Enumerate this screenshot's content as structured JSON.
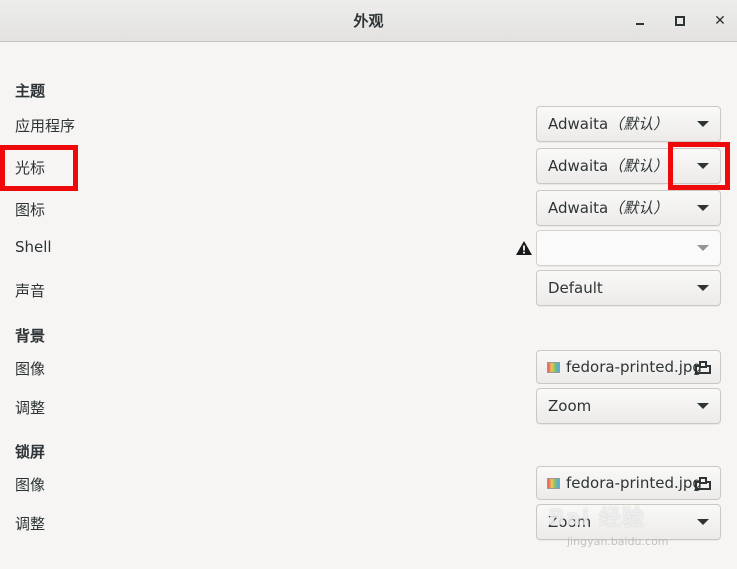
{
  "window": {
    "title": "外观",
    "controls": {
      "minimize": "minimize-icon",
      "maximize": "maximize-icon",
      "close": "close-icon"
    }
  },
  "theme": {
    "heading": "主题",
    "applications": {
      "label": "应用程序",
      "value_name": "Adwaita",
      "value_suffix": "（默认）"
    },
    "cursor": {
      "label": "光标",
      "value_name": "Adwaita",
      "value_suffix": "（默认）"
    },
    "icons": {
      "label": "图标",
      "value_name": "Adwaita",
      "value_suffix": "（默认）"
    },
    "shell": {
      "label": "Shell",
      "value": "",
      "warning_icon": "warning-icon"
    },
    "sound": {
      "label": "声音",
      "value": "Default"
    }
  },
  "background": {
    "heading": "背景",
    "image": {
      "label": "图像",
      "file": "fedora-printed.jpg"
    },
    "adjust": {
      "label": "调整",
      "value": "Zoom"
    }
  },
  "lockscreen": {
    "heading": "锁屏",
    "image": {
      "label": "图像",
      "file": "fedora-printed.jpg"
    },
    "adjust": {
      "label": "调整",
      "value": "Zoom"
    }
  },
  "watermark": {
    "text": "Bai 经验",
    "sub": "jingyan.baidu.com"
  },
  "colors": {
    "highlight": "#ee0a0a",
    "background": "#f6f5f4",
    "text": "#2e3436"
  }
}
